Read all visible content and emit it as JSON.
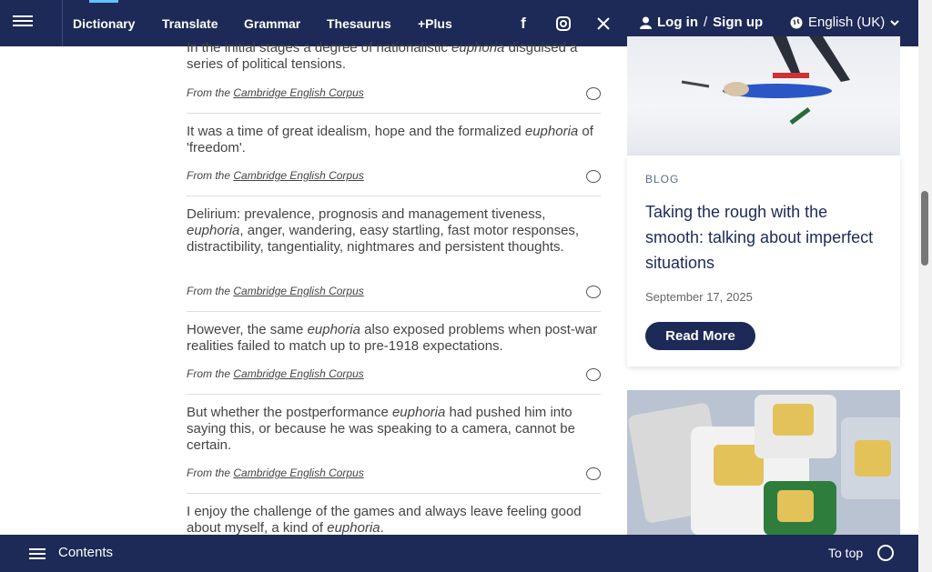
{
  "nav": {
    "items": [
      "Dictionary",
      "Translate",
      "Grammar",
      "Thesaurus",
      "+Plus"
    ],
    "login": "Log in",
    "slash": "/",
    "signup": "Sign up",
    "language": "English (UK)"
  },
  "examples": [
    {
      "text_before": "In the initial stages a degree of nationalistic ",
      "em": "euphoria",
      "text_after": " disguised a series of political tensions.",
      "from_prefix": "From the",
      "source": "Cambridge English Corpus"
    },
    {
      "text_before": "It was a time of great idealism, hope and the formalized ",
      "em": "euphoria",
      "text_after": " of 'freedom'.",
      "from_prefix": "From the",
      "source": "Cambridge English Corpus"
    },
    {
      "text_before": "Delirium: prevalence, prognosis and management tiveness, ",
      "em": "euphoria",
      "text_after": ", anger, wandering, easy startling, fast motor responses, distractibility, tangentiality, nightmares and persistent thoughts.",
      "from_prefix": "From the",
      "source": "Cambridge English Corpus"
    },
    {
      "text_before": "However, the same ",
      "em": "euphoria",
      "text_after": " also exposed problems when post-war realities failed to match up to pre-1918 expectations.",
      "from_prefix": "From the",
      "source": "Cambridge English Corpus"
    },
    {
      "text_before": "But whether the postperformance ",
      "em": "euphoria",
      "text_after": " had pushed him into saying this, or because he was speaking to a camera, cannot be certain.",
      "from_prefix": "From the",
      "source": "Cambridge English Corpus"
    },
    {
      "text_before": "I enjoy the challenge of the games and always leave feeling good about myself, a kind of ",
      "em": "euphoria",
      "text_after": ".",
      "from_prefix": "",
      "source": ""
    }
  ],
  "blog": {
    "label": "BLOG",
    "title": "Taking the rough with the smooth: talking about imperfect situations",
    "date": "September 17, 2025",
    "button": "Read More"
  },
  "bottom": {
    "contents": "Contents",
    "to_top": "To top"
  },
  "colors": {
    "brand": "#1d2a57",
    "accent": "#63c1ff"
  }
}
